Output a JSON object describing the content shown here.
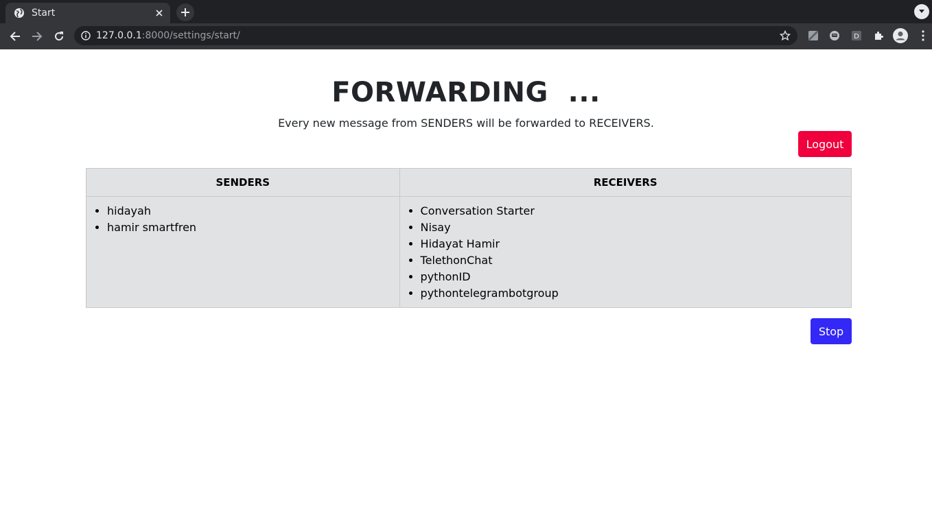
{
  "browser": {
    "tab_title": "Start",
    "url_host": "127.0.0.1",
    "url_rest": ":8000/settings/start/"
  },
  "page": {
    "title": "FORWARDING  ...",
    "subtitle": "Every new message from SENDERS will be forwarded to RECEIVERS.",
    "logout_label": "Logout",
    "stop_label": "Stop"
  },
  "table": {
    "headers": [
      "SENDERS",
      "RECEIVERS"
    ],
    "senders": [
      "hidayah",
      "hamir smartfren"
    ],
    "receivers": [
      "Conversation Starter",
      "Nisay",
      "Hidayat Hamir",
      "TelethonChat",
      "pythonID",
      "pythontelegrambotgroup"
    ]
  },
  "colors": {
    "logout": "#f0003c",
    "stop": "#3328f5",
    "table_bg": "#e1e2e4"
  }
}
